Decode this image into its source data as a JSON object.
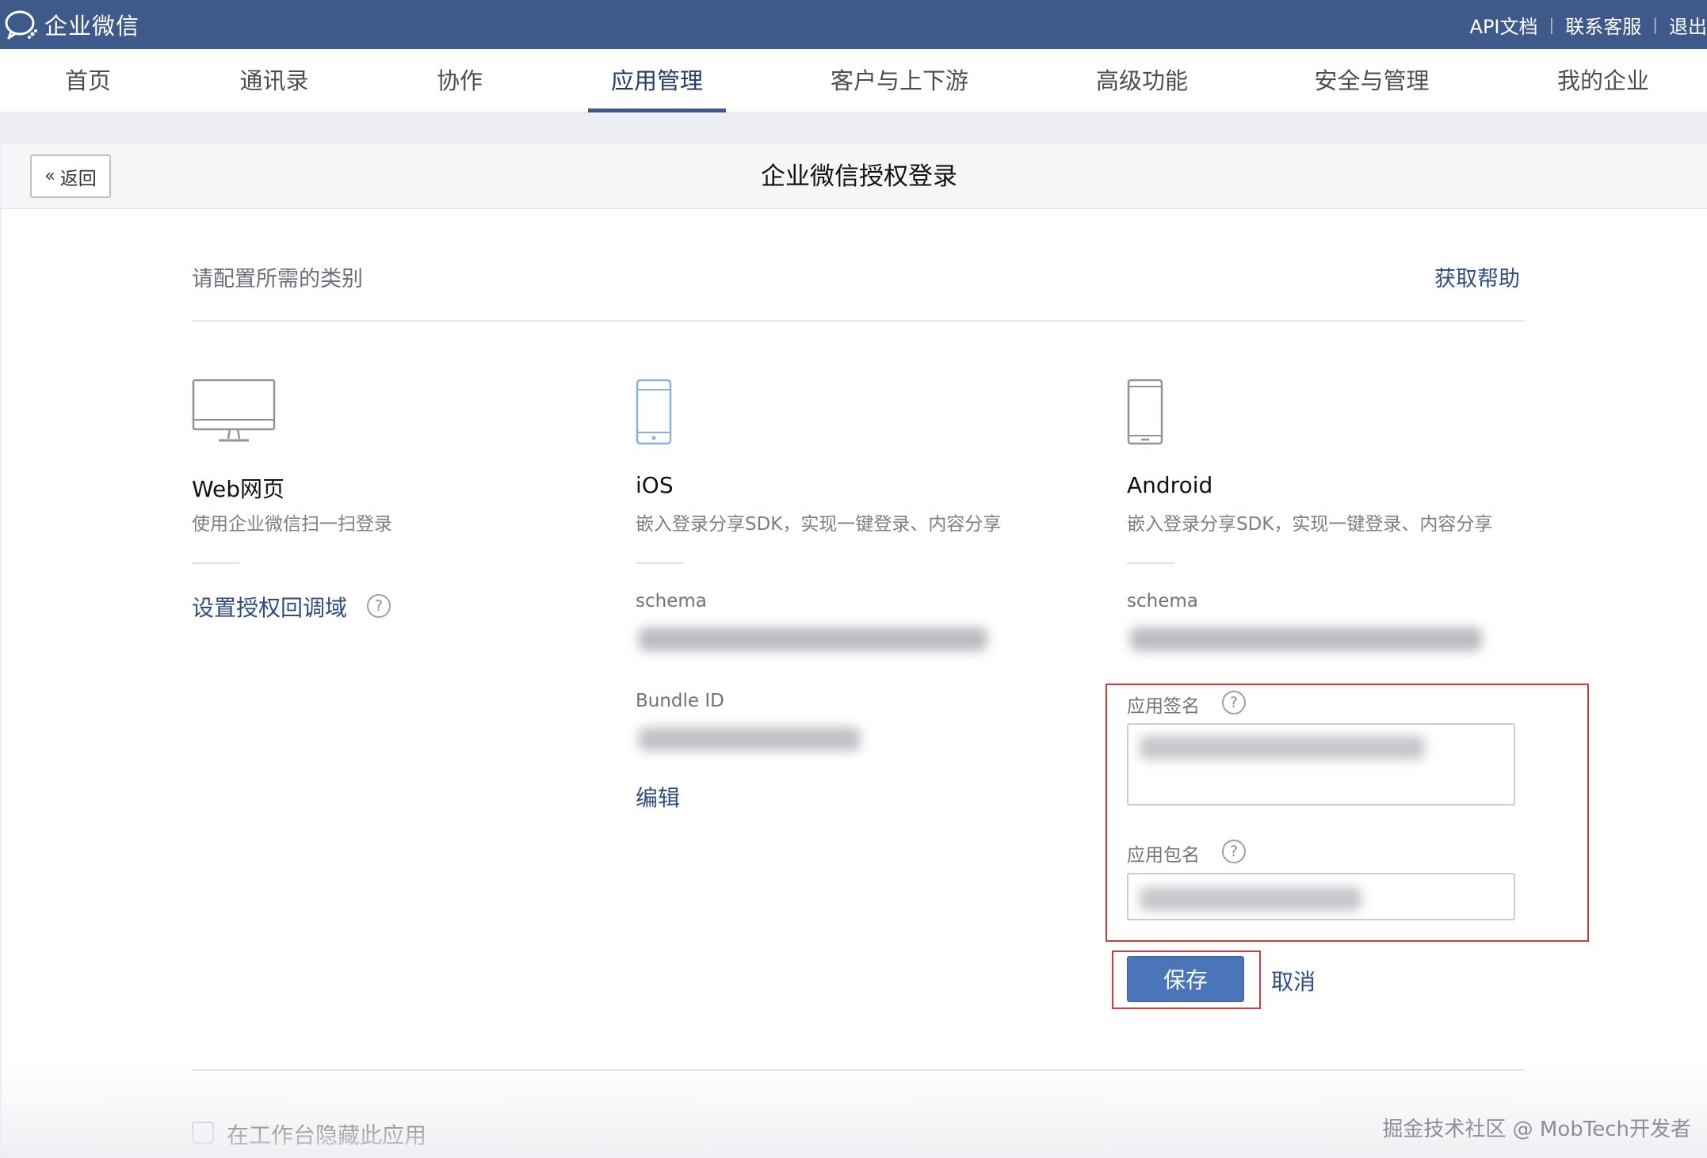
{
  "topbar": {
    "brand": "企业微信",
    "links": {
      "api": "API文档",
      "support": "联系客服",
      "logout": "退出"
    }
  },
  "nav": {
    "tabs": [
      "首页",
      "通讯录",
      "协作",
      "应用管理",
      "客户与上下游",
      "高级功能",
      "安全与管理",
      "我的企业"
    ],
    "active": "应用管理"
  },
  "page": {
    "back_label": "返回",
    "title": "企业微信授权登录",
    "section_label": "请配置所需的类别",
    "help_link": "获取帮助"
  },
  "web": {
    "title": "Web网页",
    "desc": "使用企业微信扫一扫登录",
    "link": "设置授权回调域"
  },
  "ios": {
    "title": "iOS",
    "desc": "嵌入登录分享SDK，实现一键登录、内容分享",
    "schema_label": "schema",
    "bundle_label": "Bundle ID",
    "edit_link": "编辑"
  },
  "android": {
    "title": "Android",
    "desc": "嵌入登录分享SDK，实现一键登录、内容分享",
    "schema_label": "schema",
    "sign_label": "应用签名",
    "package_label": "应用包名"
  },
  "actions": {
    "save": "保存",
    "cancel": "取消"
  },
  "footer": {
    "hide_label": "在工作台隐藏此应用",
    "watermark": "掘金技术社区 @ MobTech开发者"
  },
  "colors": {
    "brand_bar": "#3e5a8b",
    "link": "#2f4d80",
    "primary_button": "#4a75b8",
    "highlight_box": "#d23c3c"
  }
}
